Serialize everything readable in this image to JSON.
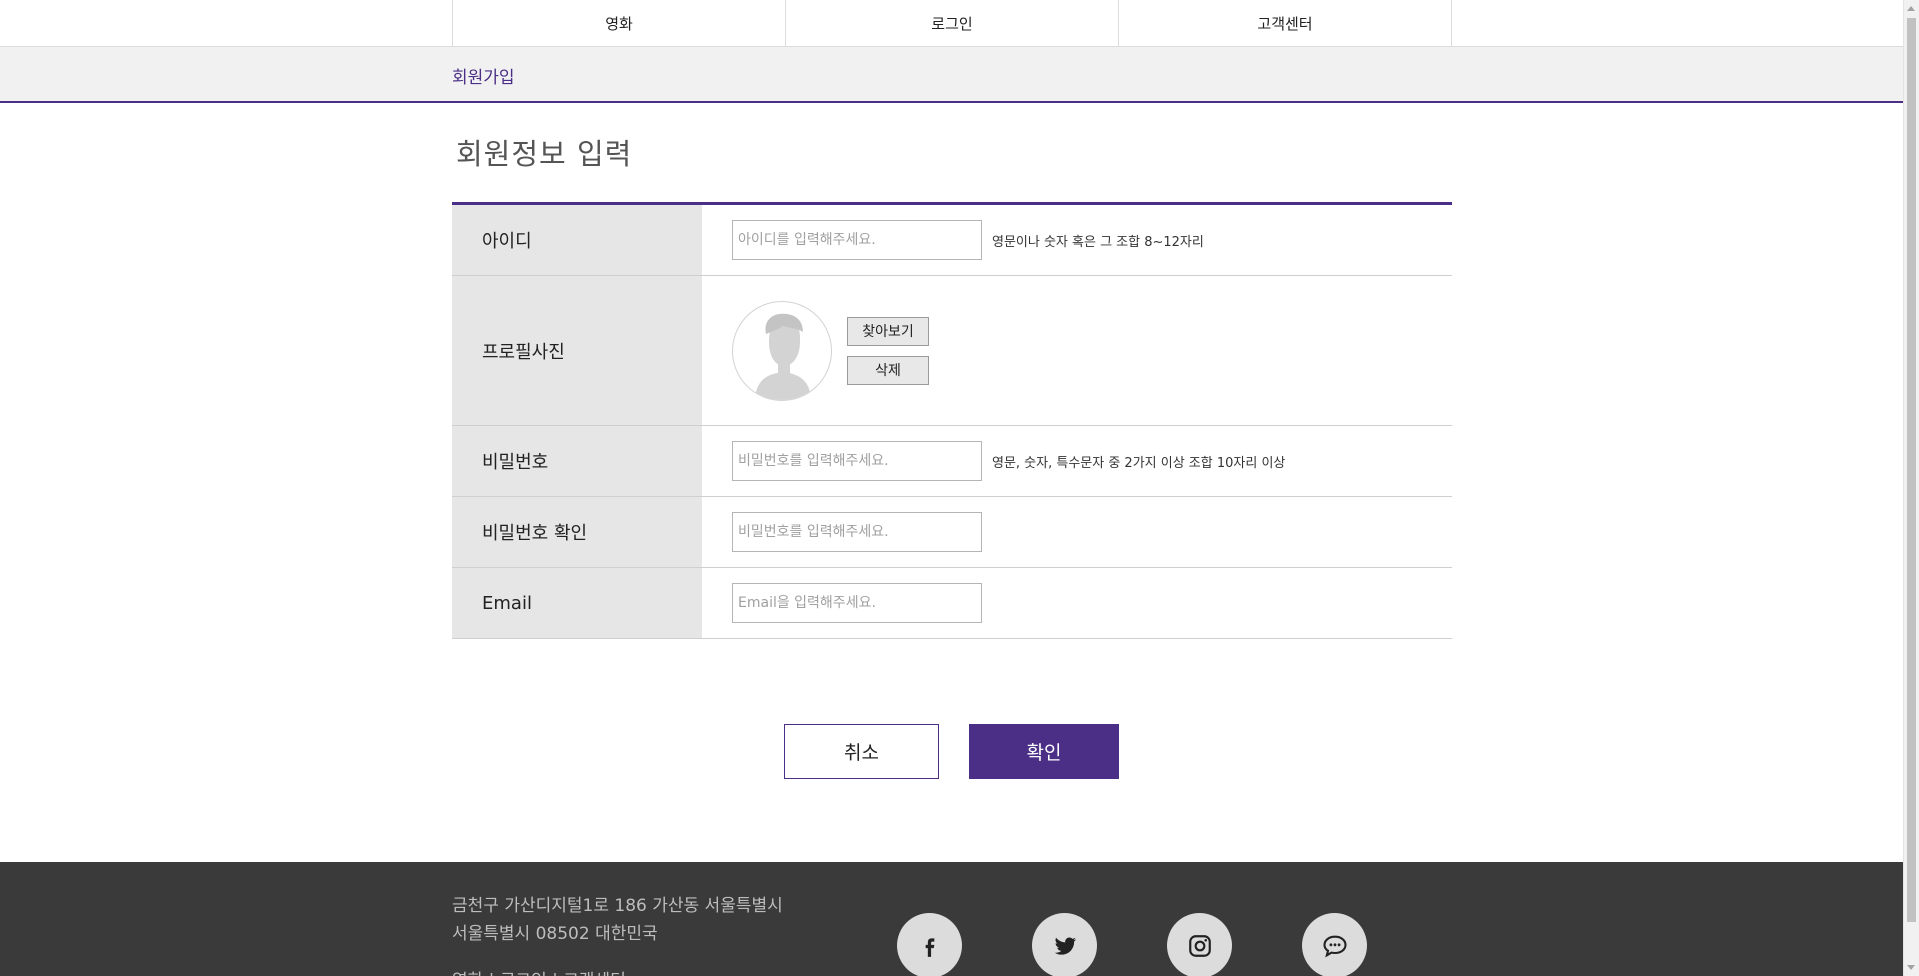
{
  "nav": {
    "items": [
      {
        "label": "영화"
      },
      {
        "label": "로그인"
      },
      {
        "label": "고객센터"
      }
    ]
  },
  "subheader": {
    "title": "회원가입"
  },
  "page": {
    "heading": "회원정보 입력"
  },
  "form": {
    "id": {
      "label": "아이디",
      "placeholder": "아이디를 입력해주세요.",
      "value": "",
      "hint": "영문이나 숫자 혹은 그 조합 8~12자리"
    },
    "photo": {
      "label": "프로필사진",
      "browse_label": "찾아보기",
      "delete_label": "삭제"
    },
    "password": {
      "label": "비밀번호",
      "placeholder": "비밀번호를 입력해주세요.",
      "value": "",
      "hint": "영문, 숫자, 특수문자 중 2가지 이상 조합 10자리 이상"
    },
    "password_confirm": {
      "label": "비밀번호 확인",
      "placeholder": "비밀번호를 입력해주세요.",
      "value": ""
    },
    "email": {
      "label": "Email",
      "placeholder": "Email을 입력해주세요.",
      "value": ""
    }
  },
  "actions": {
    "cancel_label": "취소",
    "confirm_label": "확인"
  },
  "footer": {
    "address_line1": "금천구 가산디지털1로 186 가산동 서울특별시",
    "address_line2": "서울특별시 08502 대한민국",
    "links_text": "영화 | 로그인 | 고객센터",
    "social": [
      {
        "icon": "facebook-icon"
      },
      {
        "icon": "twitter-icon"
      },
      {
        "icon": "instagram-icon"
      },
      {
        "icon": "chat-icon"
      }
    ]
  },
  "colors": {
    "accent": "#4b2f86",
    "label_bg": "#e6e6e6",
    "footer_bg": "#3a3a3a"
  }
}
